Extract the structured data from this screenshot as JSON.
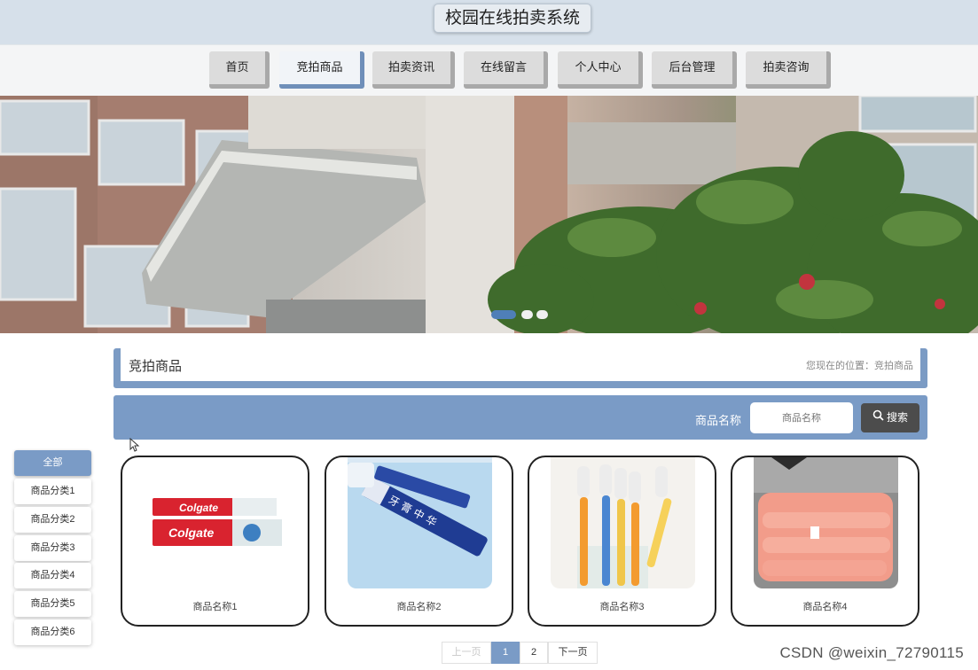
{
  "site": {
    "title": "校园在线拍卖系统"
  },
  "nav": {
    "items": [
      {
        "label": "首页"
      },
      {
        "label": "竞拍商品"
      },
      {
        "label": "拍卖资讯"
      },
      {
        "label": "在线留言"
      },
      {
        "label": "个人中心"
      },
      {
        "label": "后台管理"
      },
      {
        "label": "拍卖咨询"
      }
    ],
    "active_label": "竞拍商品"
  },
  "banner": {
    "slide_count": 3,
    "active_slide": 1
  },
  "section": {
    "title": "竞拍商品",
    "breadcrumb": "您现在的位置：竞拍商品"
  },
  "search": {
    "label": "商品名称",
    "placeholder": "商品名称",
    "button_label": "搜索"
  },
  "categories": [
    {
      "label": "全部"
    },
    {
      "label": "商品分类1"
    },
    {
      "label": "商品分类2"
    },
    {
      "label": "商品分类3"
    },
    {
      "label": "商品分类4"
    },
    {
      "label": "商品分类5"
    },
    {
      "label": "商品分类6"
    }
  ],
  "products": [
    {
      "name": "商品名称1",
      "image": "toothpaste-colgate"
    },
    {
      "name": "商品名称2",
      "image": "toothpaste-blue"
    },
    {
      "name": "商品名称3",
      "image": "toothbrushes"
    },
    {
      "name": "商品名称4",
      "image": "pink-quilt"
    }
  ],
  "pagination": {
    "prev_label": "上一页",
    "pages": [
      "1",
      "2"
    ],
    "current_page": "1",
    "next_label": "下一页"
  },
  "watermark": "CSDN @weixin_72790115",
  "colors": {
    "accent": "#7a9bc6",
    "header_bg": "#d6e0ea",
    "button_dark": "#4c4c4c"
  }
}
